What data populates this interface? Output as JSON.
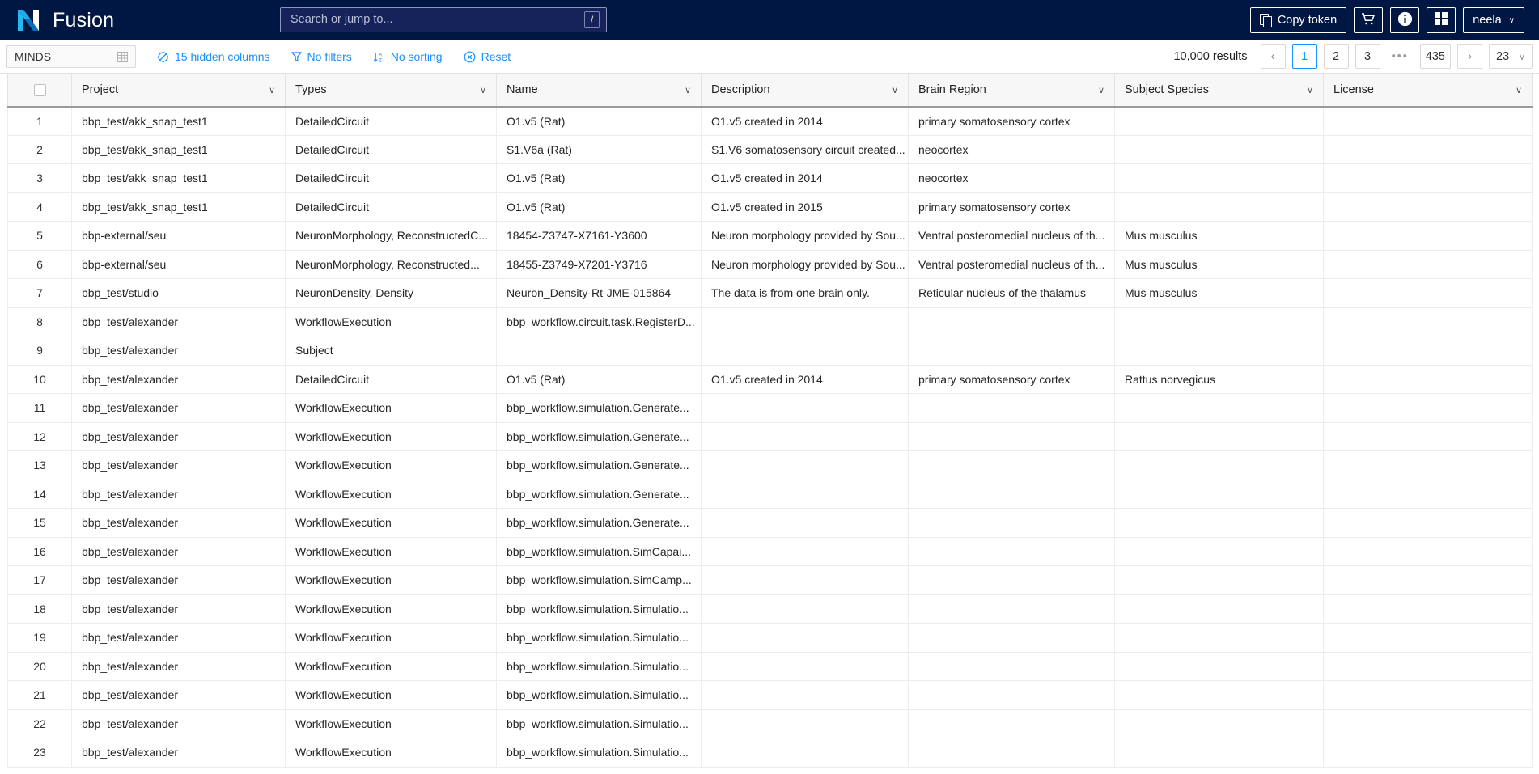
{
  "header": {
    "brand": "Fusion",
    "logo_icon": "nexus-n-logo",
    "search": {
      "placeholder": "Search or jump to...",
      "shortcut": "/"
    },
    "buttons": [
      {
        "name": "copy-token-button",
        "label": "Copy token",
        "icon": "copy-icon"
      },
      {
        "name": "cart-button",
        "label": "",
        "icon": "cart-icon"
      },
      {
        "name": "info-button",
        "label": "",
        "icon": "info-circle-icon"
      },
      {
        "name": "apps-button",
        "label": "",
        "icon": "apps-grid-icon"
      }
    ],
    "user": {
      "label": "neela",
      "caret": "∨"
    }
  },
  "toolbar": {
    "dataset_select": {
      "label": "MINDS",
      "icon": "table-grid-icon"
    },
    "actions": [
      {
        "name": "hidden-columns-button",
        "label": "15 hidden columns",
        "icon": "eye-slash-icon"
      },
      {
        "name": "filters-button",
        "label": "No filters",
        "icon": "funnel-icon"
      },
      {
        "name": "sorting-button",
        "label": "No sorting",
        "icon": "sort-az-icon"
      },
      {
        "name": "reset-button",
        "label": "Reset",
        "icon": "close-circle-icon"
      }
    ],
    "results_label": "10,000 results",
    "pagination": {
      "prev": "‹",
      "pages": [
        "1",
        "2",
        "3"
      ],
      "ellipsis": "•••",
      "last": "435",
      "next": "›",
      "active": "1",
      "page_size": "23",
      "page_size_caret": "∨"
    }
  },
  "table": {
    "columns": [
      {
        "key": "num",
        "label": ""
      },
      {
        "key": "project",
        "label": "Project"
      },
      {
        "key": "types",
        "label": "Types"
      },
      {
        "key": "name",
        "label": "Name"
      },
      {
        "key": "description",
        "label": "Description"
      },
      {
        "key": "brain_region",
        "label": "Brain Region"
      },
      {
        "key": "subject_species",
        "label": "Subject Species"
      },
      {
        "key": "license",
        "label": "License"
      }
    ],
    "rows": [
      {
        "num": "1",
        "project": "bbp_test/akk_snap_test1",
        "types": "DetailedCircuit",
        "name": "O1.v5 (Rat)",
        "description": "O1.v5 created in 2014",
        "brain_region": "primary somatosensory cortex",
        "subject_species": "",
        "license": ""
      },
      {
        "num": "2",
        "project": "bbp_test/akk_snap_test1",
        "types": "DetailedCircuit",
        "name": "S1.V6a (Rat)",
        "description": "S1.V6 somatosensory circuit created...",
        "brain_region": "neocortex",
        "subject_species": "",
        "license": ""
      },
      {
        "num": "3",
        "project": "bbp_test/akk_snap_test1",
        "types": "DetailedCircuit",
        "name": "O1.v5 (Rat)",
        "description": "O1.v5 created in 2014",
        "brain_region": "neocortex",
        "subject_species": "",
        "license": ""
      },
      {
        "num": "4",
        "project": "bbp_test/akk_snap_test1",
        "types": "DetailedCircuit",
        "name": "O1.v5 (Rat)",
        "description": "O1.v5 created in 2015",
        "brain_region": "primary somatosensory cortex",
        "subject_species": "",
        "license": ""
      },
      {
        "num": "5",
        "project": "bbp-external/seu",
        "types": "NeuronMorphology, ReconstructedC...",
        "name": "18454-Z3747-X7161-Y3600",
        "description": "Neuron morphology provided by Sou...",
        "brain_region": "Ventral posteromedial nucleus of th...",
        "subject_species": "Mus musculus",
        "license": ""
      },
      {
        "num": "6",
        "project": "bbp-external/seu",
        "types": "NeuronMorphology, Reconstructed...",
        "name": "18455-Z3749-X7201-Y3716",
        "description": "Neuron morphology provided by Sou...",
        "brain_region": "Ventral posteromedial nucleus of th...",
        "subject_species": "Mus musculus",
        "license": ""
      },
      {
        "num": "7",
        "project": "bbp_test/studio",
        "types": "NeuronDensity, Density",
        "name": "Neuron_Density-Rt-JME-015864",
        "description": "The data is from one brain only.",
        "brain_region": "Reticular nucleus of the thalamus",
        "subject_species": "Mus musculus",
        "license": "",
        "highlight": "types"
      },
      {
        "num": "8",
        "project": "bbp_test/alexander",
        "types": "WorkflowExecution",
        "name": "bbp_workflow.circuit.task.RegisterD...",
        "description": "",
        "brain_region": "",
        "subject_species": "",
        "license": ""
      },
      {
        "num": "9",
        "project": "bbp_test/alexander",
        "types": "Subject",
        "name": "",
        "description": "",
        "brain_region": "",
        "subject_species": "",
        "license": ""
      },
      {
        "num": "10",
        "project": "bbp_test/alexander",
        "types": "DetailedCircuit",
        "name": "O1.v5 (Rat)",
        "description": "O1.v5 created in 2014",
        "brain_region": "primary somatosensory cortex",
        "subject_species": "Rattus norvegicus",
        "license": ""
      },
      {
        "num": "11",
        "project": "bbp_test/alexander",
        "types": "WorkflowExecution",
        "name": "bbp_workflow.simulation.Generate...",
        "description": "",
        "brain_region": "",
        "subject_species": "",
        "license": ""
      },
      {
        "num": "12",
        "project": "bbp_test/alexander",
        "types": "WorkflowExecution",
        "name": "bbp_workflow.simulation.Generate...",
        "description": "",
        "brain_region": "",
        "subject_species": "",
        "license": ""
      },
      {
        "num": "13",
        "project": "bbp_test/alexander",
        "types": "WorkflowExecution",
        "name": "bbp_workflow.simulation.Generate...",
        "description": "",
        "brain_region": "",
        "subject_species": "",
        "license": ""
      },
      {
        "num": "14",
        "project": "bbp_test/alexander",
        "types": "WorkflowExecution",
        "name": "bbp_workflow.simulation.Generate...",
        "description": "",
        "brain_region": "",
        "subject_species": "",
        "license": ""
      },
      {
        "num": "15",
        "project": "bbp_test/alexander",
        "types": "WorkflowExecution",
        "name": "bbp_workflow.simulation.Generate...",
        "description": "",
        "brain_region": "",
        "subject_species": "",
        "license": ""
      },
      {
        "num": "16",
        "project": "bbp_test/alexander",
        "types": "WorkflowExecution",
        "name": "bbp_workflow.simulation.SimCapai...",
        "description": "",
        "brain_region": "",
        "subject_species": "",
        "license": ""
      },
      {
        "num": "17",
        "project": "bbp_test/alexander",
        "types": "WorkflowExecution",
        "name": "bbp_workflow.simulation.SimCamp...",
        "description": "",
        "brain_region": "",
        "subject_species": "",
        "license": ""
      },
      {
        "num": "18",
        "project": "bbp_test/alexander",
        "types": "WorkflowExecution",
        "name": "bbp_workflow.simulation.Simulatio...",
        "description": "",
        "brain_region": "",
        "subject_species": "",
        "license": ""
      },
      {
        "num": "19",
        "project": "bbp_test/alexander",
        "types": "WorkflowExecution",
        "name": "bbp_workflow.simulation.Simulatio...",
        "description": "",
        "brain_region": "",
        "subject_species": "",
        "license": ""
      },
      {
        "num": "20",
        "project": "bbp_test/alexander",
        "types": "WorkflowExecution",
        "name": "bbp_workflow.simulation.Simulatio...",
        "description": "",
        "brain_region": "",
        "subject_species": "",
        "license": ""
      },
      {
        "num": "21",
        "project": "bbp_test/alexander",
        "types": "WorkflowExecution",
        "name": "bbp_workflow.simulation.Simulatio...",
        "description": "",
        "brain_region": "",
        "subject_species": "",
        "license": ""
      },
      {
        "num": "22",
        "project": "bbp_test/alexander",
        "types": "WorkflowExecution",
        "name": "bbp_workflow.simulation.Simulatio...",
        "description": "",
        "brain_region": "",
        "subject_species": "",
        "license": ""
      },
      {
        "num": "23",
        "project": "bbp_test/alexander",
        "types": "WorkflowExecution",
        "name": "bbp_workflow.simulation.Simulatio...",
        "description": "",
        "brain_region": "",
        "subject_species": "",
        "license": ""
      }
    ],
    "header_chevron": "∨"
  },
  "colors": {
    "header_bg": "#001744",
    "accent": "#1890ff",
    "logo_cyan": "#22b8f0"
  }
}
